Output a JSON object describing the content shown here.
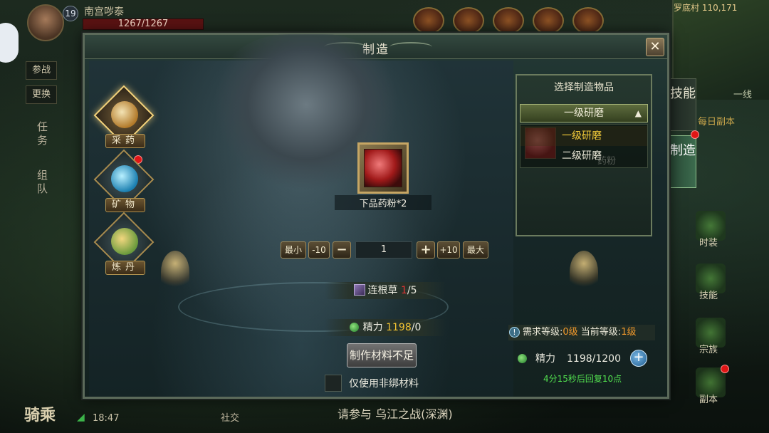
{
  "hud": {
    "player_level": "19",
    "player_name": "南宫哕泰",
    "hp": "1267/1267",
    "map_name": "罗底村 110,171",
    "line": "一线",
    "daily": "每日副本",
    "side_buttons": [
      "参战",
      "更换"
    ],
    "left_tabs": [
      "任务",
      "组队"
    ],
    "mount": "骑乘",
    "clock": "18:47",
    "chat": "请参与 乌江之战(深渊)",
    "social": "社交",
    "right_labels": [
      "时装",
      "技能",
      "宗族",
      "副本"
    ]
  },
  "side_tabs": {
    "skill": "技能",
    "make": "制造"
  },
  "dialog": {
    "title": "制造",
    "close": "✕",
    "categories": [
      {
        "label": "采药",
        "active": true,
        "color": "#d7a64b"
      },
      {
        "label": "矿物",
        "active": false,
        "color": "#38a8d8"
      },
      {
        "label": "炼丹",
        "active": false,
        "color": "#d2a93e"
      }
    ],
    "product": {
      "name": "下品药粉*2"
    },
    "quantity": {
      "min_label": "最小",
      "minus10_label": "-10",
      "minus_label": "−",
      "value": "1",
      "plus_label": "+",
      "plus10_label": "+10",
      "max_label": "最大"
    },
    "material": {
      "name": "连根草",
      "have": "1",
      "need": "/5"
    },
    "energy_cost": {
      "label": "精力",
      "value": "1198",
      "cost": "/0"
    },
    "craft_button": "制作材料不足",
    "nonbind_label": "仅使用非绑材料",
    "item_panel": {
      "title": "选择制造物品",
      "dropdown_selected": "一级研磨",
      "dropdown_arrow": "▲",
      "options": [
        "一级研磨",
        "二级研磨"
      ],
      "ghost_text": "药粉"
    },
    "requirement": {
      "info_icon": "!",
      "req_label": "需求等级:",
      "req_value": "0级",
      "cur_label": " 当前等级:",
      "cur_value": "1级"
    },
    "energy": {
      "label": "精力",
      "value": "1198/1200",
      "add": "+"
    },
    "recover": "4分15秒后回复10点"
  }
}
